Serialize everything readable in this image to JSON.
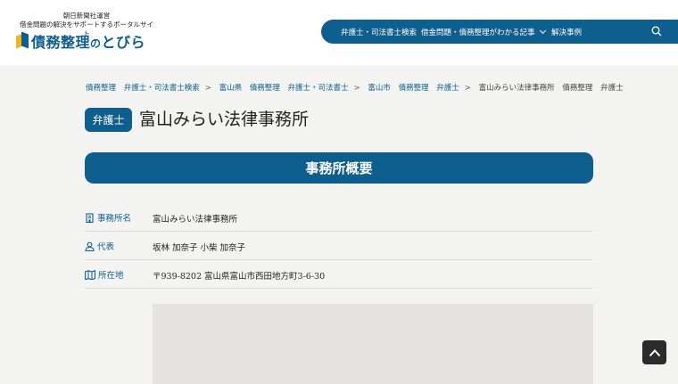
{
  "header": {
    "tagline_1": "朝日新聞社運営",
    "tagline_2": "借金問題の解決をサポートするポータルサイト",
    "logo_main": "債務整理",
    "logo_no": "の",
    "logo_end": "とびら"
  },
  "nav": {
    "items": [
      "弁護士・司法書士検索",
      "借金問題・債務整理がわかる記事",
      "解決事例"
    ],
    "search_icon": "search-icon"
  },
  "breadcrumb": {
    "items": [
      "債務整理",
      "弁護士・司法書士検索",
      "富山県",
      "債務整理",
      "弁護士・司法書士",
      "富山市",
      "債務整理",
      "弁護士",
      "富山みらい法律事務所",
      "債務整理",
      "弁護士"
    ],
    "separator": ">"
  },
  "page": {
    "badge": "弁護士",
    "title": "富山みらい法律事務所"
  },
  "section": {
    "title": "事務所概要"
  },
  "info": {
    "rows": [
      {
        "label": "事務所名",
        "value": "富山みらい法律事務所",
        "icon": "building-icon"
      },
      {
        "label": "代表",
        "value": "坂林 加奈子 小柴 加奈子",
        "icon": "person-icon"
      },
      {
        "label": "所在地",
        "value": "〒939-8202 富山県富山市西田地方町3-6-30",
        "icon": "map-icon"
      }
    ]
  },
  "colors": {
    "primary": "#0e5f8e",
    "accent": "#f1b51c",
    "background": "#f3f3f1"
  }
}
